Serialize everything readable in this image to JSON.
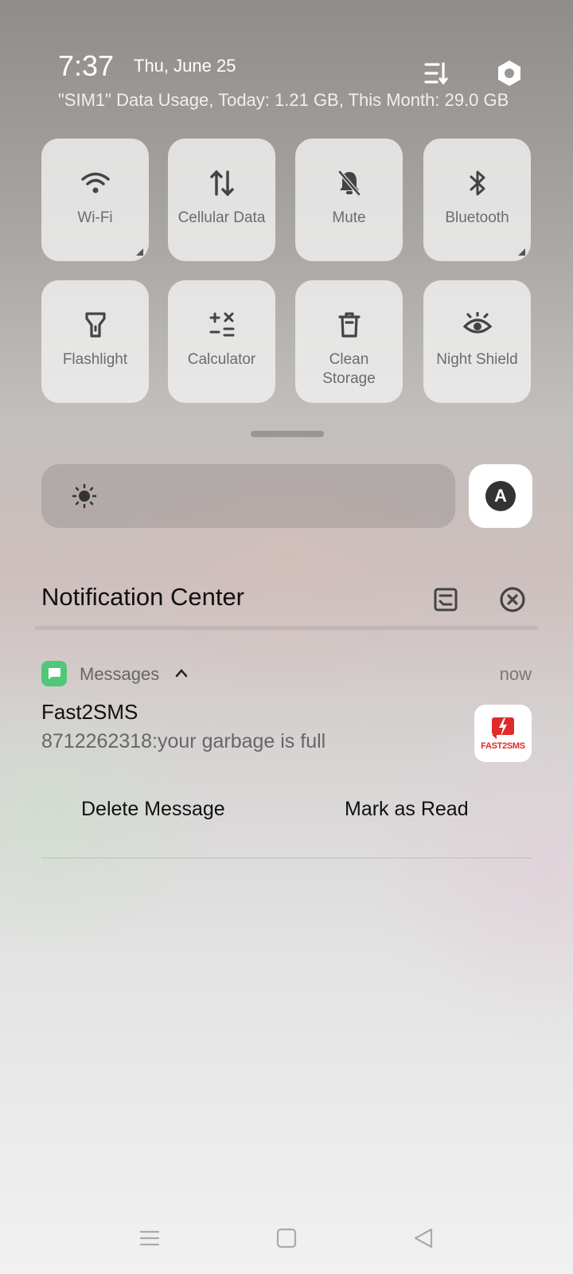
{
  "status": {
    "time": "7:37",
    "date": "Thu, June 25",
    "data_usage": "\"SIM1\" Data Usage, Today: 1.21 GB, This Month: 29.0 GB",
    "edit_icon": "sort-edit-icon",
    "settings_icon": "settings-hexagon-icon"
  },
  "tiles": [
    {
      "label": "Wi-Fi",
      "icon": "wifi-icon",
      "has_more": true
    },
    {
      "label": "Cellular Data",
      "icon": "cellular-data-icon",
      "has_more": false
    },
    {
      "label": "Mute",
      "icon": "bell-off-icon",
      "has_more": false
    },
    {
      "label": "Bluetooth",
      "icon": "bluetooth-icon",
      "has_more": true
    },
    {
      "label": "Flashlight",
      "icon": "flashlight-icon",
      "has_more": false
    },
    {
      "label": "Calculator",
      "icon": "calculator-icon",
      "has_more": false
    },
    {
      "label": "Clean Storage",
      "icon": "trash-icon",
      "has_more": false
    },
    {
      "label": "Night Shield",
      "icon": "eye-icon",
      "has_more": false
    }
  ],
  "brightness": {
    "icon": "sun-icon",
    "auto_label": "A"
  },
  "notification_center": {
    "title": "Notification Center",
    "manage_icon": "manage-notifications-icon",
    "clear_icon": "clear-all-icon"
  },
  "notification": {
    "app": "Messages",
    "time": "now",
    "sender": "Fast2SMS",
    "message": "8712262318:your garbage is full",
    "thumbnail_text": "FAST2SMS",
    "actions": {
      "delete": "Delete Message",
      "read": "Mark as Read"
    }
  },
  "nav": {
    "menu_icon": "menu-icon",
    "home_icon": "home-square-icon",
    "back_icon": "back-triangle-icon"
  },
  "colors": {
    "accent_green": "#4fc878",
    "brand_red": "#e02a2a"
  }
}
